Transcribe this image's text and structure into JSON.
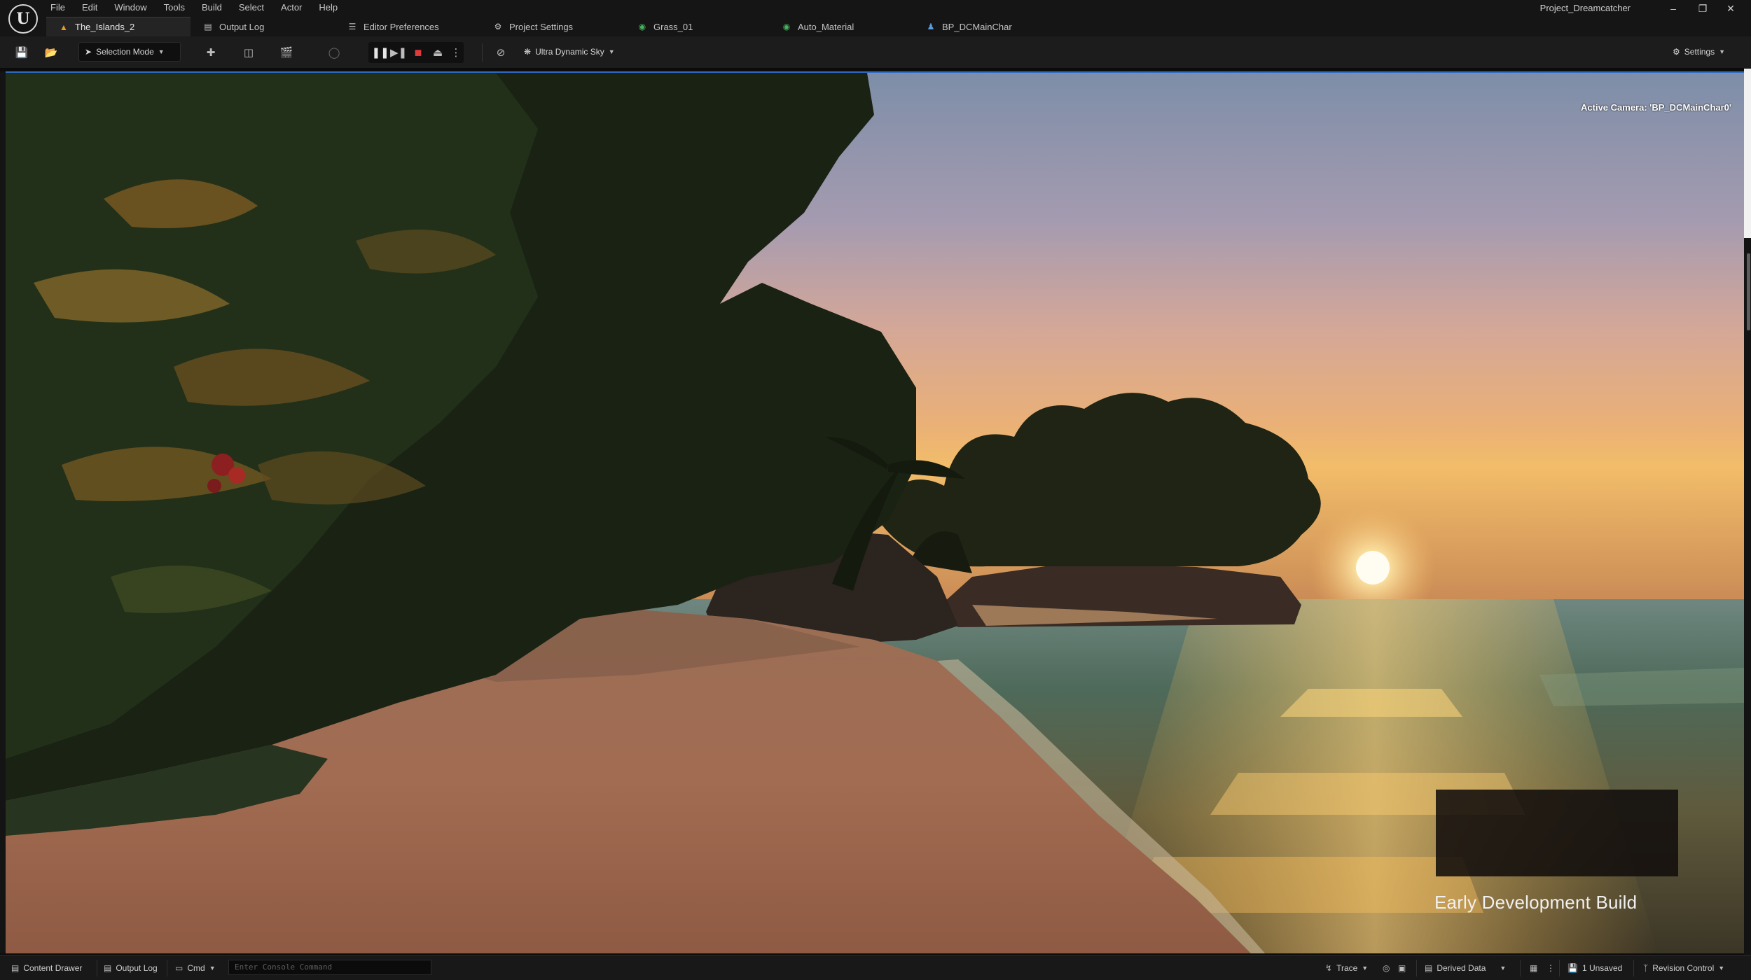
{
  "app": {
    "logo_text": "U",
    "project_name": "Project_Dreamcatcher"
  },
  "menu": [
    "File",
    "Edit",
    "Window",
    "Tools",
    "Build",
    "Select",
    "Actor",
    "Help"
  ],
  "tabs": [
    {
      "label": "The_Islands_2",
      "icon": "level-icon",
      "active": true
    },
    {
      "label": "Output Log",
      "icon": "log-icon"
    },
    {
      "label": "Editor Preferences",
      "icon": "sliders-icon"
    },
    {
      "label": "Project Settings",
      "icon": "settings-icon"
    },
    {
      "label": "Grass_01",
      "icon": "material-icon"
    },
    {
      "label": "Auto_Material",
      "icon": "material-icon"
    },
    {
      "label": "BP_DCMainChar",
      "icon": "blueprint-icon"
    }
  ],
  "toolbar": {
    "selection_mode": "Selection Mode",
    "sky_label": "Ultra Dynamic Sky",
    "settings_label": "Settings"
  },
  "viewport": {
    "active_camera": "Active Camera: 'BP_DCMainChar0'",
    "build_label": "Early Development Build"
  },
  "statusbar": {
    "content_drawer": "Content Drawer",
    "output_log": "Output Log",
    "cmd": "Cmd",
    "console_placeholder": "Enter Console Command",
    "trace": "Trace",
    "derived_data": "Derived Data",
    "unsaved": "1 Unsaved",
    "revision_control": "Revision Control"
  },
  "colors": {
    "accent": "#2e6bc6",
    "stop": "#e03a3a",
    "level_tab_icon": "#e39a2a",
    "material_icon": "#44b25b",
    "blueprint_icon": "#5b9ddf"
  }
}
